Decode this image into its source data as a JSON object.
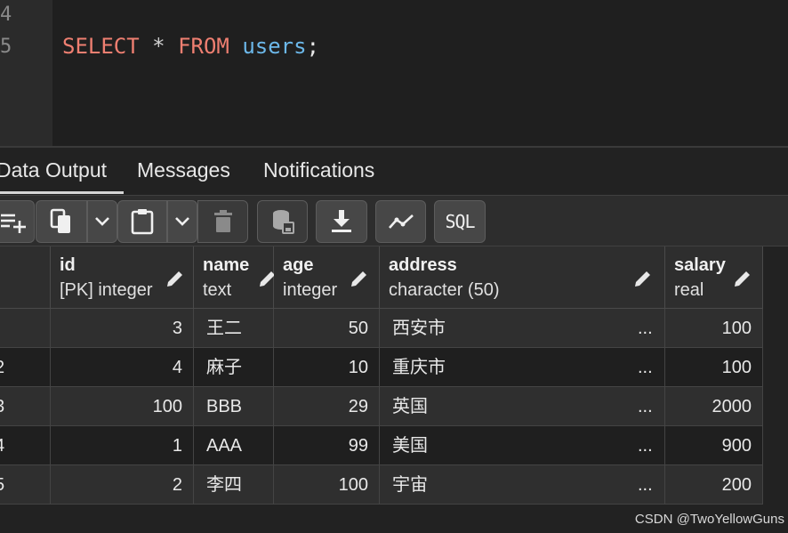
{
  "editor": {
    "line_numbers": [
      "4",
      "5"
    ],
    "code": {
      "kw_select": "SELECT",
      "star": "*",
      "kw_from": "FROM",
      "table": "users",
      "semicolon": ";"
    }
  },
  "tabs": [
    {
      "label": "Data Output",
      "active": true
    },
    {
      "label": "Messages",
      "active": false
    },
    {
      "label": "Notifications",
      "active": false
    }
  ],
  "toolbar": {
    "buttons": [
      {
        "icon": "add-row-icon",
        "enabled": true
      },
      {
        "icon": "copy-icon",
        "enabled": true
      },
      {
        "icon": "chevron-down-icon",
        "enabled": true
      },
      {
        "icon": "paste-icon",
        "enabled": true
      },
      {
        "icon": "chevron-down-icon",
        "enabled": true
      },
      {
        "icon": "delete-icon",
        "enabled": false
      },
      {
        "icon": "save-data-icon",
        "enabled": false
      },
      {
        "icon": "download-icon",
        "enabled": true
      },
      {
        "icon": "graph-visualiser-icon",
        "enabled": true
      },
      {
        "icon": "sql-icon",
        "enabled": true
      }
    ],
    "sql_label": "SQL"
  },
  "columns": [
    {
      "name": "id",
      "type": "[PK] integer"
    },
    {
      "name": "name",
      "type": "text"
    },
    {
      "name": "age",
      "type": "integer"
    },
    {
      "name": "address",
      "type": "character (50)"
    },
    {
      "name": "salary",
      "type": "real"
    }
  ],
  "rows": [
    {
      "num": "",
      "id": "3",
      "name": "王二",
      "age": "50",
      "address": "西安市",
      "more": "...",
      "salary": "100"
    },
    {
      "num": "2",
      "id": "4",
      "name": "麻子",
      "age": "10",
      "address": "重庆市",
      "more": "...",
      "salary": "100"
    },
    {
      "num": "3",
      "id": "100",
      "name": "BBB",
      "age": "29",
      "address": "英国",
      "more": "...",
      "salary": "2000"
    },
    {
      "num": "4",
      "id": "1",
      "name": "AAA",
      "age": "99",
      "address": "美国",
      "more": "...",
      "salary": "900"
    },
    {
      "num": "5",
      "id": "2",
      "name": "李四",
      "age": "100",
      "address": "宇宙",
      "more": "...",
      "salary": "200"
    }
  ],
  "watermark": "CSDN @TwoYellowGuns",
  "colors": {
    "keyword": "#ef7f71",
    "identifier": "#6cb8ea",
    "background": "#222222"
  }
}
